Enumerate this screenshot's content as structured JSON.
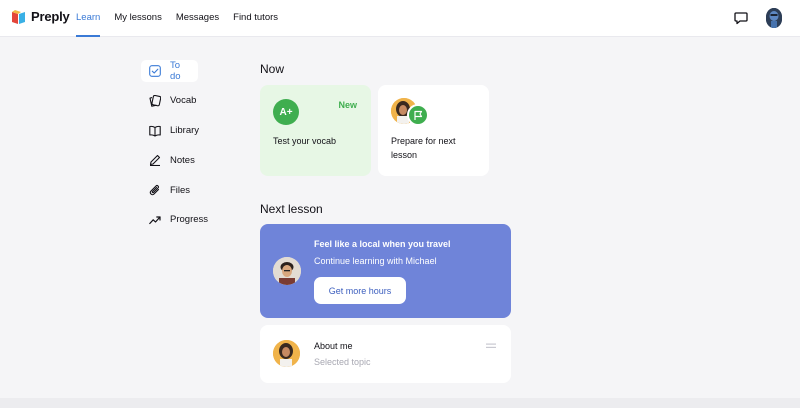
{
  "app": {
    "brand": "Preply"
  },
  "nav": {
    "items": [
      {
        "label": "Learn",
        "active": true
      },
      {
        "label": "My lessons",
        "active": false
      },
      {
        "label": "Messages",
        "active": false
      },
      {
        "label": "Find tutors",
        "active": false
      }
    ]
  },
  "header": {
    "icons": [
      "chat-icon",
      "user-avatar"
    ]
  },
  "sidebar": {
    "items": [
      {
        "label": "To do",
        "icon": "check-square-icon",
        "active": true
      },
      {
        "label": "Vocab",
        "icon": "cards-icon",
        "active": false
      },
      {
        "label": "Library",
        "icon": "book-icon",
        "active": false
      },
      {
        "label": "Notes",
        "icon": "pencil-icon",
        "active": false
      },
      {
        "label": "Files",
        "icon": "paperclip-icon",
        "active": false
      },
      {
        "label": "Progress",
        "icon": "trend-icon",
        "active": false
      }
    ]
  },
  "now": {
    "title": "Now",
    "cards": [
      {
        "label": "Test your vocab",
        "badge": "New",
        "icon_text": "A+"
      },
      {
        "label_line1": "Prepare for next",
        "label_line2": "lesson"
      }
    ]
  },
  "next_lesson": {
    "title": "Next lesson",
    "banner_title": "Feel like a local when you travel",
    "banner_sub": "Continue learning with Michael",
    "button_label": "Get more hours"
  },
  "about": {
    "title": "About me",
    "subtitle": "Selected topic"
  },
  "colors": {
    "accent": "#3a7ad6",
    "green": "#3fae4f",
    "banner": "#6f84d9"
  }
}
